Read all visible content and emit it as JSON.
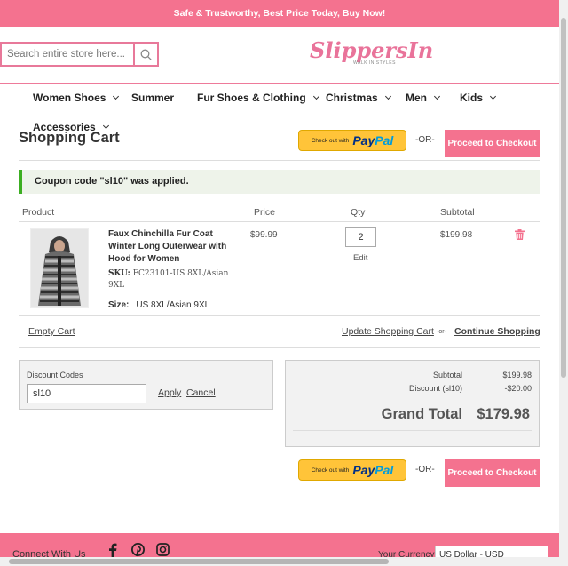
{
  "topbar": {
    "text": "Safe & Trustworthy, Best Price Today, Buy Now!"
  },
  "search": {
    "placeholder": "Search entire store here...",
    "icon": "search-icon"
  },
  "logo": {
    "text": "SlippersIn",
    "tagline": "WALK IN STYLES"
  },
  "nav": [
    {
      "label": "Women Shoes",
      "has_dropdown": true
    },
    {
      "label": "Summer",
      "has_dropdown": false
    },
    {
      "label": "Fur Shoes & Clothing",
      "has_dropdown": true
    },
    {
      "label": "Christmas",
      "has_dropdown": true
    },
    {
      "label": "Men",
      "has_dropdown": true
    },
    {
      "label": "Kids",
      "has_dropdown": true
    },
    {
      "label": "Accessories",
      "has_dropdown": true
    }
  ],
  "cart": {
    "title": "Shopping Cart",
    "paypal": {
      "prefix": "Check out with",
      "brand_a": "Pay",
      "brand_b": "Pal"
    },
    "or_label": "-OR-",
    "checkout_label": "Proceed to Checkout",
    "notice": "Coupon code \"sl10\" was applied.",
    "columns": {
      "product": "Product",
      "price": "Price",
      "qty": "Qty",
      "subtotal": "Subtotal"
    },
    "items": [
      {
        "name": "Faux Chinchilla Fur Coat Winter Long Outerwear with Hood for Women",
        "sku_label": "SKU:",
        "sku": "FC23101-US 8XL/Asian 9XL",
        "size_label": "Size:",
        "size": "US 8XL/Asian 9XL",
        "price": "$99.99",
        "qty": "2",
        "edit_label": "Edit",
        "subtotal": "$199.98",
        "remove_icon": "trash-icon"
      }
    ],
    "empty_cart_label": "Empty Cart",
    "update_cart_label": "Update Shopping Cart",
    "or_small": "-or-",
    "continue_label": "Continue Shopping"
  },
  "discount": {
    "label": "Discount Codes",
    "value": "sl10",
    "apply_label": "Apply",
    "cancel_label": "Cancel"
  },
  "totals": {
    "subtotal_label": "Subtotal",
    "subtotal_value": "$199.98",
    "discount_label": "Discount (sl10)",
    "discount_value": "-$20.00",
    "grand_total_label": "Grand Total",
    "grand_total_value": "$179.98"
  },
  "footer": {
    "connect_label": "Connect With Us",
    "social_icons": [
      "facebook-icon",
      "pinterest-icon",
      "instagram-icon"
    ],
    "currency_label": "Your Currency:",
    "currency_value": "US Dollar - USD"
  },
  "colors": {
    "brand_pink": "#f4728f",
    "success_green": "#3cae22",
    "paypal_yellow": "#ffc439"
  }
}
